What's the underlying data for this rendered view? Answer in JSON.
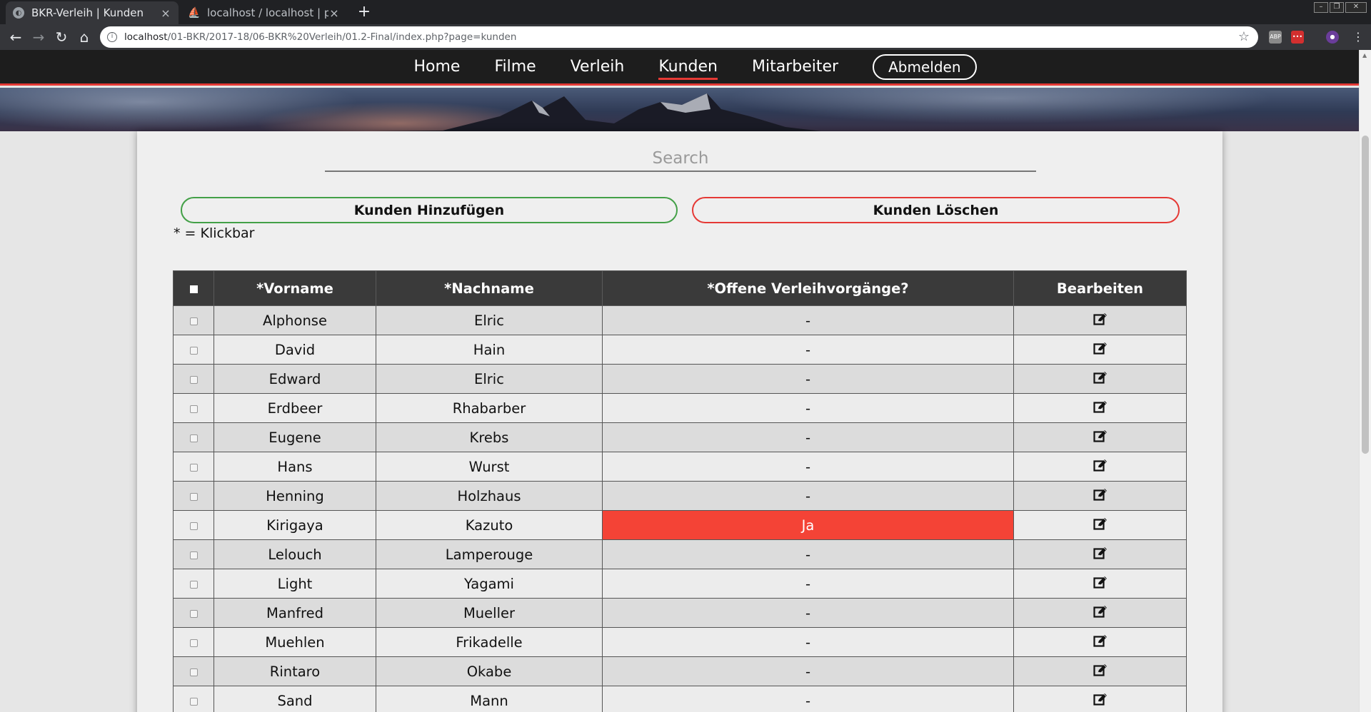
{
  "browser": {
    "tabs": [
      {
        "title": "BKR-Verleih | Kunden",
        "active": true
      },
      {
        "title": "localhost / localhost | php",
        "active": false
      }
    ],
    "new_tab": "+",
    "url_host": "localhost",
    "url_path": "/01-BKR/2017-18/06-BKR%20Verleih/01.2-Final/index.php?page=kunden"
  },
  "nav": {
    "items": [
      {
        "label": "Home",
        "active": false
      },
      {
        "label": "Filme",
        "active": false
      },
      {
        "label": "Verleih",
        "active": false
      },
      {
        "label": "Kunden",
        "active": true
      },
      {
        "label": "Mitarbeiter",
        "active": false
      }
    ],
    "logout_label": "Abmelden"
  },
  "search": {
    "placeholder": "Search",
    "value": ""
  },
  "actions": {
    "add_label": "Kunden Hinzufügen",
    "delete_label": "Kunden Löschen",
    "add_color": "#43a047",
    "delete_color": "#e53935"
  },
  "note": "* = Klickbar",
  "table": {
    "headers": [
      "*Vorname",
      "*Nachname",
      "*Offene Verleihvorgänge?",
      "Bearbeiten"
    ],
    "rows": [
      {
        "vorname": "Alphonse",
        "nachname": "Elric",
        "offen": "-"
      },
      {
        "vorname": "David",
        "nachname": "Hain",
        "offen": "-"
      },
      {
        "vorname": "Edward",
        "nachname": "Elric",
        "offen": "-"
      },
      {
        "vorname": "Erdbeer",
        "nachname": "Rhabarber",
        "offen": "-"
      },
      {
        "vorname": "Eugene",
        "nachname": "Krebs",
        "offen": "-"
      },
      {
        "vorname": "Hans",
        "nachname": "Wurst",
        "offen": "-"
      },
      {
        "vorname": "Henning",
        "nachname": "Holzhaus",
        "offen": "-"
      },
      {
        "vorname": "Kirigaya",
        "nachname": "Kazuto",
        "offen": "Ja"
      },
      {
        "vorname": "Lelouch",
        "nachname": "Lamperouge",
        "offen": "-"
      },
      {
        "vorname": "Light",
        "nachname": "Yagami",
        "offen": "-"
      },
      {
        "vorname": "Manfred",
        "nachname": "Mueller",
        "offen": "-"
      },
      {
        "vorname": "Muehlen",
        "nachname": "Frikadelle",
        "offen": "-"
      },
      {
        "vorname": "Rintaro",
        "nachname": "Okabe",
        "offen": "-"
      },
      {
        "vorname": "Sand",
        "nachname": "Mann",
        "offen": "-"
      }
    ],
    "highlight_color": "#f44336",
    "edit_icon": "edit-icon"
  }
}
